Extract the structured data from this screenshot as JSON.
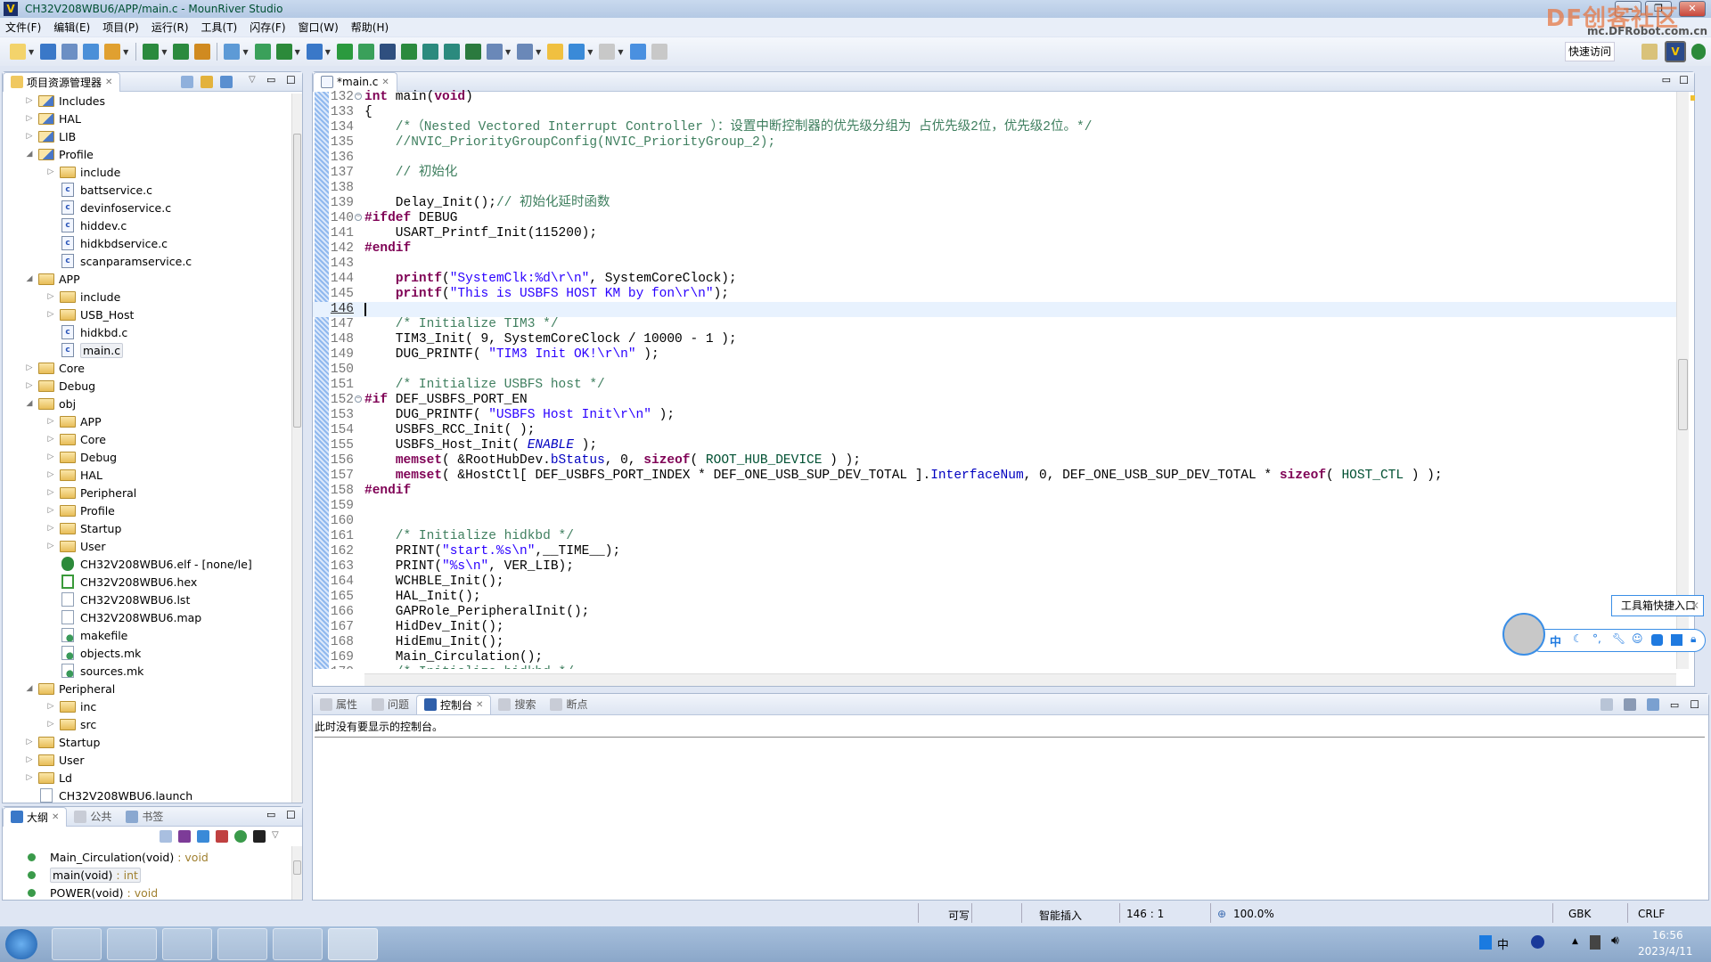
{
  "window": {
    "title": "CH32V208WBU6/APP/main.c - MounRiver Studio",
    "minimize": "—",
    "restore": "❐",
    "close": "✕"
  },
  "watermark": {
    "brand": "DF创客社区",
    "url": "mc.DFRobot.com.cn"
  },
  "menu": [
    "文件(F)",
    "编辑(E)",
    "项目(P)",
    "运行(R)",
    "工具(T)",
    "闪存(F)",
    "窗口(W)",
    "帮助(H)"
  ],
  "toolbar": {
    "icons": [
      {
        "name": "new-icon",
        "color": "#f3d36b",
        "dd": true
      },
      {
        "name": "save-icon",
        "color": "#3a78c8"
      },
      {
        "name": "save-all-icon",
        "color": "#6c8fc4"
      },
      {
        "name": "save-as-icon",
        "color": "#4a8fd8"
      },
      {
        "name": "build-config-icon",
        "color": "#e0a030",
        "dd": true
      },
      {
        "sep": true
      },
      {
        "name": "download-icon",
        "color": "#2b8a3e",
        "dd": true
      },
      {
        "name": "build-all-icon",
        "color": "#2b8a3e"
      },
      {
        "name": "layers-icon",
        "color": "#d08a20"
      },
      {
        "sep": true
      },
      {
        "name": "import-icon",
        "color": "#5d9ad6",
        "dd": true
      },
      {
        "name": "terminal-window-icon",
        "color": "#3aa05a"
      },
      {
        "name": "debug-bug-icon",
        "color": "#2c8a3a",
        "dd": true
      },
      {
        "name": "search-icon",
        "color": "#3a78c8",
        "dd": true
      },
      {
        "name": "id-icon",
        "color": "#2b9a3e"
      },
      {
        "name": "help-doc-icon",
        "color": "#3aa05a"
      },
      {
        "name": "console-icon",
        "color": "#2f4f7f"
      },
      {
        "name": "refresh-icon",
        "color": "#2b8a3e"
      },
      {
        "name": "indent-icon",
        "color": "#2b8a7e"
      },
      {
        "name": "outdent-icon",
        "color": "#2b8a7e"
      },
      {
        "name": "format-clear-icon",
        "color": "#2b7a3e"
      },
      {
        "name": "list-icon",
        "color": "#6a88b8",
        "dd": true
      },
      {
        "name": "outline-list-icon",
        "color": "#6a88b8",
        "dd": true
      },
      {
        "name": "back-annotation-icon",
        "color": "#f0c040"
      },
      {
        "name": "back-arrow-icon",
        "color": "#3a8ad8",
        "dd": true
      },
      {
        "name": "forward-arrow-icon",
        "color": "#c8c8c8",
        "dd": true
      },
      {
        "name": "checkmark-icon",
        "color": "#4a90e0"
      },
      {
        "name": "checkmark-disabled-icon",
        "color": "#c8c8c8"
      }
    ],
    "quick_access": "快速访问",
    "perspective_icons": [
      "open-perspective-icon",
      "mounriver-perspective-icon",
      "debug-perspective-icon"
    ]
  },
  "explorer": {
    "title": "项目资源管理器",
    "items": [
      {
        "label": "Includes",
        "depth": 0,
        "exp": "closed",
        "icon": "includes-icon"
      },
      {
        "label": "HAL",
        "depth": 0,
        "exp": "closed",
        "icon": "source-folder-icon"
      },
      {
        "label": "LIB",
        "depth": 0,
        "exp": "closed",
        "icon": "source-folder-icon"
      },
      {
        "label": "Profile",
        "depth": 0,
        "exp": "open",
        "icon": "source-folder-icon"
      },
      {
        "label": "include",
        "depth": 1,
        "exp": "closed",
        "icon": "folder-icon"
      },
      {
        "label": "battservice.c",
        "depth": 1,
        "exp": "none",
        "icon": "c-file-icon"
      },
      {
        "label": "devinfoservice.c",
        "depth": 1,
        "exp": "none",
        "icon": "c-file-icon"
      },
      {
        "label": "hiddev.c",
        "depth": 1,
        "exp": "none",
        "icon": "c-file-icon"
      },
      {
        "label": "hidkbdservice.c",
        "depth": 1,
        "exp": "none",
        "icon": "c-file-icon"
      },
      {
        "label": "scanparamservice.c",
        "depth": 1,
        "exp": "none",
        "icon": "c-file-icon"
      },
      {
        "label": "APP",
        "depth": 0,
        "exp": "open",
        "icon": "folder-icon"
      },
      {
        "label": "include",
        "depth": 1,
        "exp": "closed",
        "icon": "folder-icon"
      },
      {
        "label": "USB_Host",
        "depth": 1,
        "exp": "closed",
        "icon": "folder-icon"
      },
      {
        "label": "hidkbd.c",
        "depth": 1,
        "exp": "none",
        "icon": "c-file-icon"
      },
      {
        "label": "main.c",
        "depth": 1,
        "exp": "none",
        "icon": "c-file-icon",
        "selected": true
      },
      {
        "label": "Core",
        "depth": 0,
        "exp": "closed",
        "icon": "folder-icon"
      },
      {
        "label": "Debug",
        "depth": 0,
        "exp": "closed",
        "icon": "folder-icon"
      },
      {
        "label": "obj",
        "depth": 0,
        "exp": "open",
        "icon": "folder-icon"
      },
      {
        "label": "APP",
        "depth": 1,
        "exp": "closed",
        "icon": "folder-icon"
      },
      {
        "label": "Core",
        "depth": 1,
        "exp": "closed",
        "icon": "folder-icon"
      },
      {
        "label": "Debug",
        "depth": 1,
        "exp": "closed",
        "icon": "folder-icon"
      },
      {
        "label": "HAL",
        "depth": 1,
        "exp": "closed",
        "icon": "folder-icon"
      },
      {
        "label": "Peripheral",
        "depth": 1,
        "exp": "closed",
        "icon": "folder-icon"
      },
      {
        "label": "Profile",
        "depth": 1,
        "exp": "closed",
        "icon": "folder-icon"
      },
      {
        "label": "Startup",
        "depth": 1,
        "exp": "closed",
        "icon": "folder-icon"
      },
      {
        "label": "User",
        "depth": 1,
        "exp": "closed",
        "icon": "folder-icon"
      },
      {
        "label": "CH32V208WBU6.elf - [none/le]",
        "depth": 1,
        "exp": "none",
        "icon": "elf-bug-icon"
      },
      {
        "label": "CH32V208WBU6.hex",
        "depth": 1,
        "exp": "none",
        "icon": "hex-file-icon"
      },
      {
        "label": "CH32V208WBU6.lst",
        "depth": 1,
        "exp": "none",
        "icon": "text-file-icon"
      },
      {
        "label": "CH32V208WBU6.map",
        "depth": 1,
        "exp": "none",
        "icon": "text-file-icon"
      },
      {
        "label": "makefile",
        "depth": 1,
        "exp": "none",
        "icon": "make-file-icon"
      },
      {
        "label": "objects.mk",
        "depth": 1,
        "exp": "none",
        "icon": "make-file-icon"
      },
      {
        "label": "sources.mk",
        "depth": 1,
        "exp": "none",
        "icon": "make-file-icon"
      },
      {
        "label": "Peripheral",
        "depth": 0,
        "exp": "open",
        "icon": "folder-icon"
      },
      {
        "label": "inc",
        "depth": 1,
        "exp": "closed",
        "icon": "folder-icon"
      },
      {
        "label": "src",
        "depth": 1,
        "exp": "closed",
        "icon": "folder-icon"
      },
      {
        "label": "Startup",
        "depth": 0,
        "exp": "closed",
        "icon": "folder-icon"
      },
      {
        "label": "User",
        "depth": 0,
        "exp": "closed",
        "icon": "folder-icon"
      },
      {
        "label": "Ld",
        "depth": 0,
        "exp": "closed",
        "icon": "folder-icon"
      },
      {
        "label": "CH32V208WBU6.launch",
        "depth": 0,
        "exp": "none",
        "icon": "text-file-icon"
      }
    ]
  },
  "outline": {
    "tabs": [
      "大纲",
      "公共",
      "书签"
    ],
    "items": [
      {
        "name": "Main_Circulation(void)",
        "type": " : void"
      },
      {
        "name": "main(void)",
        "type": " : int",
        "selected": true
      },
      {
        "name": "POWER(void)",
        "type": " : void"
      }
    ]
  },
  "editor": {
    "tab": "*main.c",
    "current_line": 146,
    "lines": [
      {
        "n": 132,
        "t": [
          [
            "k",
            "int"
          ],
          [
            "p",
            " main("
          ],
          [
            "k",
            "void"
          ],
          [
            "p",
            ")"
          ]
        ]
      },
      {
        "n": 133,
        "t": [
          [
            "p",
            "{"
          ]
        ]
      },
      {
        "n": 134,
        "t": [
          [
            "c",
            "    /*（Nested Vectored Interrupt Controller ）：设置中断控制器的优先级分组为 占优先级2位，优先级2位。*/"
          ]
        ]
      },
      {
        "n": 135,
        "t": [
          [
            "c",
            "    //NVIC_PriorityGroupConfig(NVIC_PriorityGroup_2);"
          ]
        ]
      },
      {
        "n": 136,
        "t": []
      },
      {
        "n": 137,
        "t": [
          [
            "c",
            "    // 初始化"
          ]
        ]
      },
      {
        "n": 138,
        "t": []
      },
      {
        "n": 139,
        "t": [
          [
            "p",
            "    Delay_Init();"
          ],
          [
            "c",
            "// 初始化延时函数"
          ]
        ]
      },
      {
        "n": 140,
        "t": [
          [
            "k",
            "#ifdef"
          ],
          [
            "p",
            " DEBUG"
          ]
        ]
      },
      {
        "n": 141,
        "t": [
          [
            "p",
            "    USART_Printf_Init(115200);"
          ]
        ]
      },
      {
        "n": 142,
        "t": [
          [
            "k",
            "#endif"
          ]
        ]
      },
      {
        "n": 143,
        "t": []
      },
      {
        "n": 144,
        "t": [
          [
            "p",
            "    "
          ],
          [
            "k",
            "printf"
          ],
          [
            "p",
            "("
          ],
          [
            "s",
            "\"SystemClk:%d\\r\\n\""
          ],
          [
            "p",
            ", SystemCoreClock);"
          ]
        ]
      },
      {
        "n": 145,
        "t": [
          [
            "p",
            "    "
          ],
          [
            "k",
            "printf"
          ],
          [
            "p",
            "("
          ],
          [
            "s",
            "\"This is USBFS HOST KM by fon\\r\\n\""
          ],
          [
            "p",
            ");"
          ]
        ]
      },
      {
        "n": 146,
        "t": []
      },
      {
        "n": 147,
        "t": [
          [
            "c",
            "    /* Initialize TIM3 */"
          ]
        ]
      },
      {
        "n": 148,
        "t": [
          [
            "p",
            "    TIM3_Init( 9, SystemCoreClock / 10000 - 1 );"
          ]
        ]
      },
      {
        "n": 149,
        "t": [
          [
            "p",
            "    DUG_PRINTF( "
          ],
          [
            "s",
            "\"TIM3 Init OK!\\r\\n\""
          ],
          [
            "p",
            " );"
          ]
        ]
      },
      {
        "n": 150,
        "t": []
      },
      {
        "n": 151,
        "t": [
          [
            "c",
            "    /* Initialize USBFS host */"
          ]
        ]
      },
      {
        "n": 152,
        "t": [
          [
            "k",
            "#if"
          ],
          [
            "p",
            " DEF_USBFS_PORT_EN"
          ]
        ]
      },
      {
        "n": 153,
        "t": [
          [
            "p",
            "    DUG_PRINTF( "
          ],
          [
            "s",
            "\"USBFS Host Init\\r\\n\""
          ],
          [
            "p",
            " );"
          ]
        ]
      },
      {
        "n": 154,
        "t": [
          [
            "p",
            "    USBFS_RCC_Init( );"
          ]
        ]
      },
      {
        "n": 155,
        "t": [
          [
            "p",
            "    USBFS_Host_Init( "
          ],
          [
            "e",
            "ENABLE"
          ],
          [
            "p",
            " );"
          ]
        ]
      },
      {
        "n": 156,
        "t": [
          [
            "p",
            "    "
          ],
          [
            "k",
            "memset"
          ],
          [
            "p",
            "( &RootHubDev."
          ],
          [
            "f",
            "bStatus"
          ],
          [
            "p",
            ", 0, "
          ],
          [
            "k",
            "sizeof"
          ],
          [
            "p",
            "( "
          ],
          [
            "t",
            "ROOT_HUB_DEVICE"
          ],
          [
            "p",
            " ) );"
          ]
        ]
      },
      {
        "n": 157,
        "t": [
          [
            "p",
            "    "
          ],
          [
            "k",
            "memset"
          ],
          [
            "p",
            "( &HostCtl[ DEF_USBFS_PORT_INDEX * DEF_ONE_USB_SUP_DEV_TOTAL ]."
          ],
          [
            "f",
            "InterfaceNum"
          ],
          [
            "p",
            ", 0, DEF_ONE_USB_SUP_DEV_TOTAL * "
          ],
          [
            "k",
            "sizeof"
          ],
          [
            "p",
            "( "
          ],
          [
            "t",
            "HOST_CTL"
          ],
          [
            "p",
            " ) );"
          ]
        ]
      },
      {
        "n": 158,
        "t": [
          [
            "k",
            "#endif"
          ]
        ]
      },
      {
        "n": 159,
        "t": []
      },
      {
        "n": 160,
        "t": []
      },
      {
        "n": 161,
        "t": [
          [
            "c",
            "    /* Initialize hidkbd */"
          ]
        ]
      },
      {
        "n": 162,
        "t": [
          [
            "p",
            "    PRINT("
          ],
          [
            "s",
            "\"start.%s\\n\""
          ],
          [
            "p",
            ",__TIME__);"
          ]
        ]
      },
      {
        "n": 163,
        "t": [
          [
            "p",
            "    PRINT("
          ],
          [
            "s",
            "\"%s\\n\""
          ],
          [
            "p",
            ", VER_LIB);"
          ]
        ]
      },
      {
        "n": 164,
        "t": [
          [
            "p",
            "    WCHBLE_Init();"
          ]
        ]
      },
      {
        "n": 165,
        "t": [
          [
            "p",
            "    HAL_Init();"
          ]
        ]
      },
      {
        "n": 166,
        "t": [
          [
            "p",
            "    GAPRole_PeripheralInit();"
          ]
        ]
      },
      {
        "n": 167,
        "t": [
          [
            "p",
            "    HidDev_Init();"
          ]
        ]
      },
      {
        "n": 168,
        "t": [
          [
            "p",
            "    HidEmu_Init();"
          ]
        ]
      },
      {
        "n": 169,
        "t": [
          [
            "p",
            "    Main_Circulation();"
          ]
        ]
      },
      {
        "n": 170,
        "t": [
          [
            "c",
            "    /* Initialize hidkbd */"
          ]
        ]
      }
    ]
  },
  "console": {
    "tabs": [
      {
        "label": "属性",
        "icon": "properties-icon"
      },
      {
        "label": "问题",
        "icon": "problems-icon"
      },
      {
        "label": "控制台",
        "icon": "console-icon",
        "active": true
      },
      {
        "label": "搜索",
        "icon": "search-icon"
      },
      {
        "label": "断点",
        "icon": "breakpoints-icon"
      }
    ],
    "message": "此时没有要显示的控制台。"
  },
  "status": {
    "writable": "可写",
    "insert_mode": "智能插入",
    "position": "146 : 1",
    "zoom": "100.0%",
    "encoding": "GBK",
    "line_ending": "CRLF"
  },
  "ime": {
    "tooltip": "工具箱快捷入口",
    "mode": "中",
    "close": "✕"
  },
  "taskbar": {
    "apps": [
      "start-button",
      "file-explorer-icon",
      "chrome-icon",
      "wechat-icon",
      "sublime-icon",
      "notepad-icon",
      "mounriver-icon"
    ],
    "tray_ime": "中",
    "time": "16:56",
    "date": "2023/4/11"
  },
  "colors": {
    "keyword": "#7f0055",
    "comment": "#3f7f5f",
    "string": "#2a00ff",
    "field": "#0000c0",
    "current_line": "#e8f2fe"
  }
}
